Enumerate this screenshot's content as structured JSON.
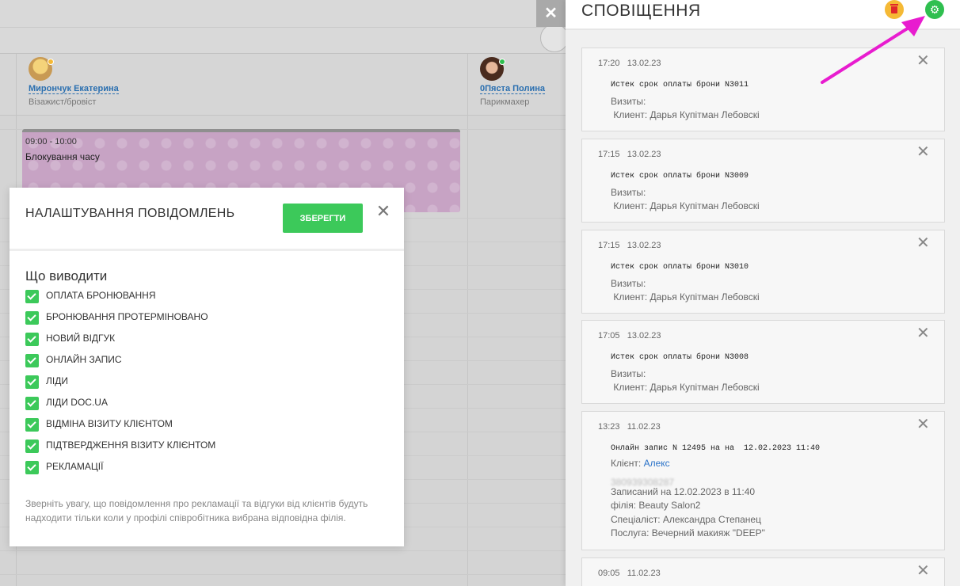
{
  "background": {
    "staff": [
      {
        "name": "Мирончук Екатерина",
        "role": "Візажист/бровіст",
        "status_color": "#f5b935"
      },
      {
        "name": "0Пяста Полина",
        "role": "Парикмахер",
        "status_color": "#2fbf4f"
      }
    ],
    "event": {
      "time": "09:00 - 10:00",
      "title": "Блокування часу"
    }
  },
  "settings": {
    "title": "НАЛАШТУВАННЯ ПОВІДОМЛЕНЬ",
    "save_label": "ЗБЕРЕГТИ",
    "section_title": "Що виводити",
    "options": [
      {
        "label": "ОПЛАТА БРОНЮВАННЯ",
        "checked": true
      },
      {
        "label": "БРОНЮВАННЯ ПРОТЕРМІНОВАНО",
        "checked": true
      },
      {
        "label": "НОВИЙ ВІДГУК",
        "checked": true
      },
      {
        "label": "ОНЛАЙН ЗАПИС",
        "checked": true
      },
      {
        "label": "ЛІДИ",
        "checked": true
      },
      {
        "label": "ЛІДИ DOC.UA",
        "checked": true
      },
      {
        "label": "ВІДМІНА ВІЗИТУ КЛІЄНТОМ",
        "checked": true
      },
      {
        "label": "ПІДТВЕРДЖЕННЯ ВІЗИТУ КЛІЄНТОМ",
        "checked": true
      },
      {
        "label": "РЕКЛАМАЦІЇ",
        "checked": true
      }
    ],
    "note": "Зверніть увагу, що повідомлення про рекламації та відгуки від клієнтів будуть надходити тільки коли у профілі співробітника вибрана відповідна філія."
  },
  "panel": {
    "title": "СПОВІЩЕННЯ",
    "notifications": [
      {
        "time": "17:20",
        "date": "13.02.23",
        "message": "Истек срок оплаты брони N3011",
        "visits_label": "Визиты:",
        "client_line": " Клиент: Дарья Купітман Лебовскі"
      },
      {
        "time": "17:15",
        "date": "13.02.23",
        "message": "Истек срок оплаты брони N3009",
        "visits_label": "Визиты:",
        "client_line": " Клиент: Дарья Купітман Лебовскі"
      },
      {
        "time": "17:15",
        "date": "13.02.23",
        "message": "Истек срок оплаты брони N3010",
        "visits_label": "Визиты:",
        "client_line": " Клиент: Дарья Купітман Лебовскі"
      },
      {
        "time": "17:05",
        "date": "13.02.23",
        "message": "Истек срок оплаты брони N3008",
        "visits_label": "Визиты:",
        "client_line": " Клиент: Дарья Купітман Лебовскі"
      }
    ],
    "online_booking": {
      "time": "13:23",
      "date": "11.02.23",
      "message": "Онлайн запис N 12495 на на  12.02.2023 11:40",
      "client_label": "Клієнт: ",
      "client_name": "Алекс",
      "phone_blurred": "380939308287",
      "booked": "Записаний на 12.02.2023 в 11:40",
      "branch": "філія: Beauty Salon2",
      "specialist": "Спеціаліст: Александра Степанец",
      "service": "Послуга: Вечерний макияж \"DEEP\""
    },
    "last_card": {
      "time": "09:05",
      "date": "11.02.23"
    }
  },
  "colors": {
    "accent_green": "#3cc95a",
    "trash_bg": "#f5b935",
    "arrow": "#e81ccf",
    "link": "#2a72c8"
  }
}
